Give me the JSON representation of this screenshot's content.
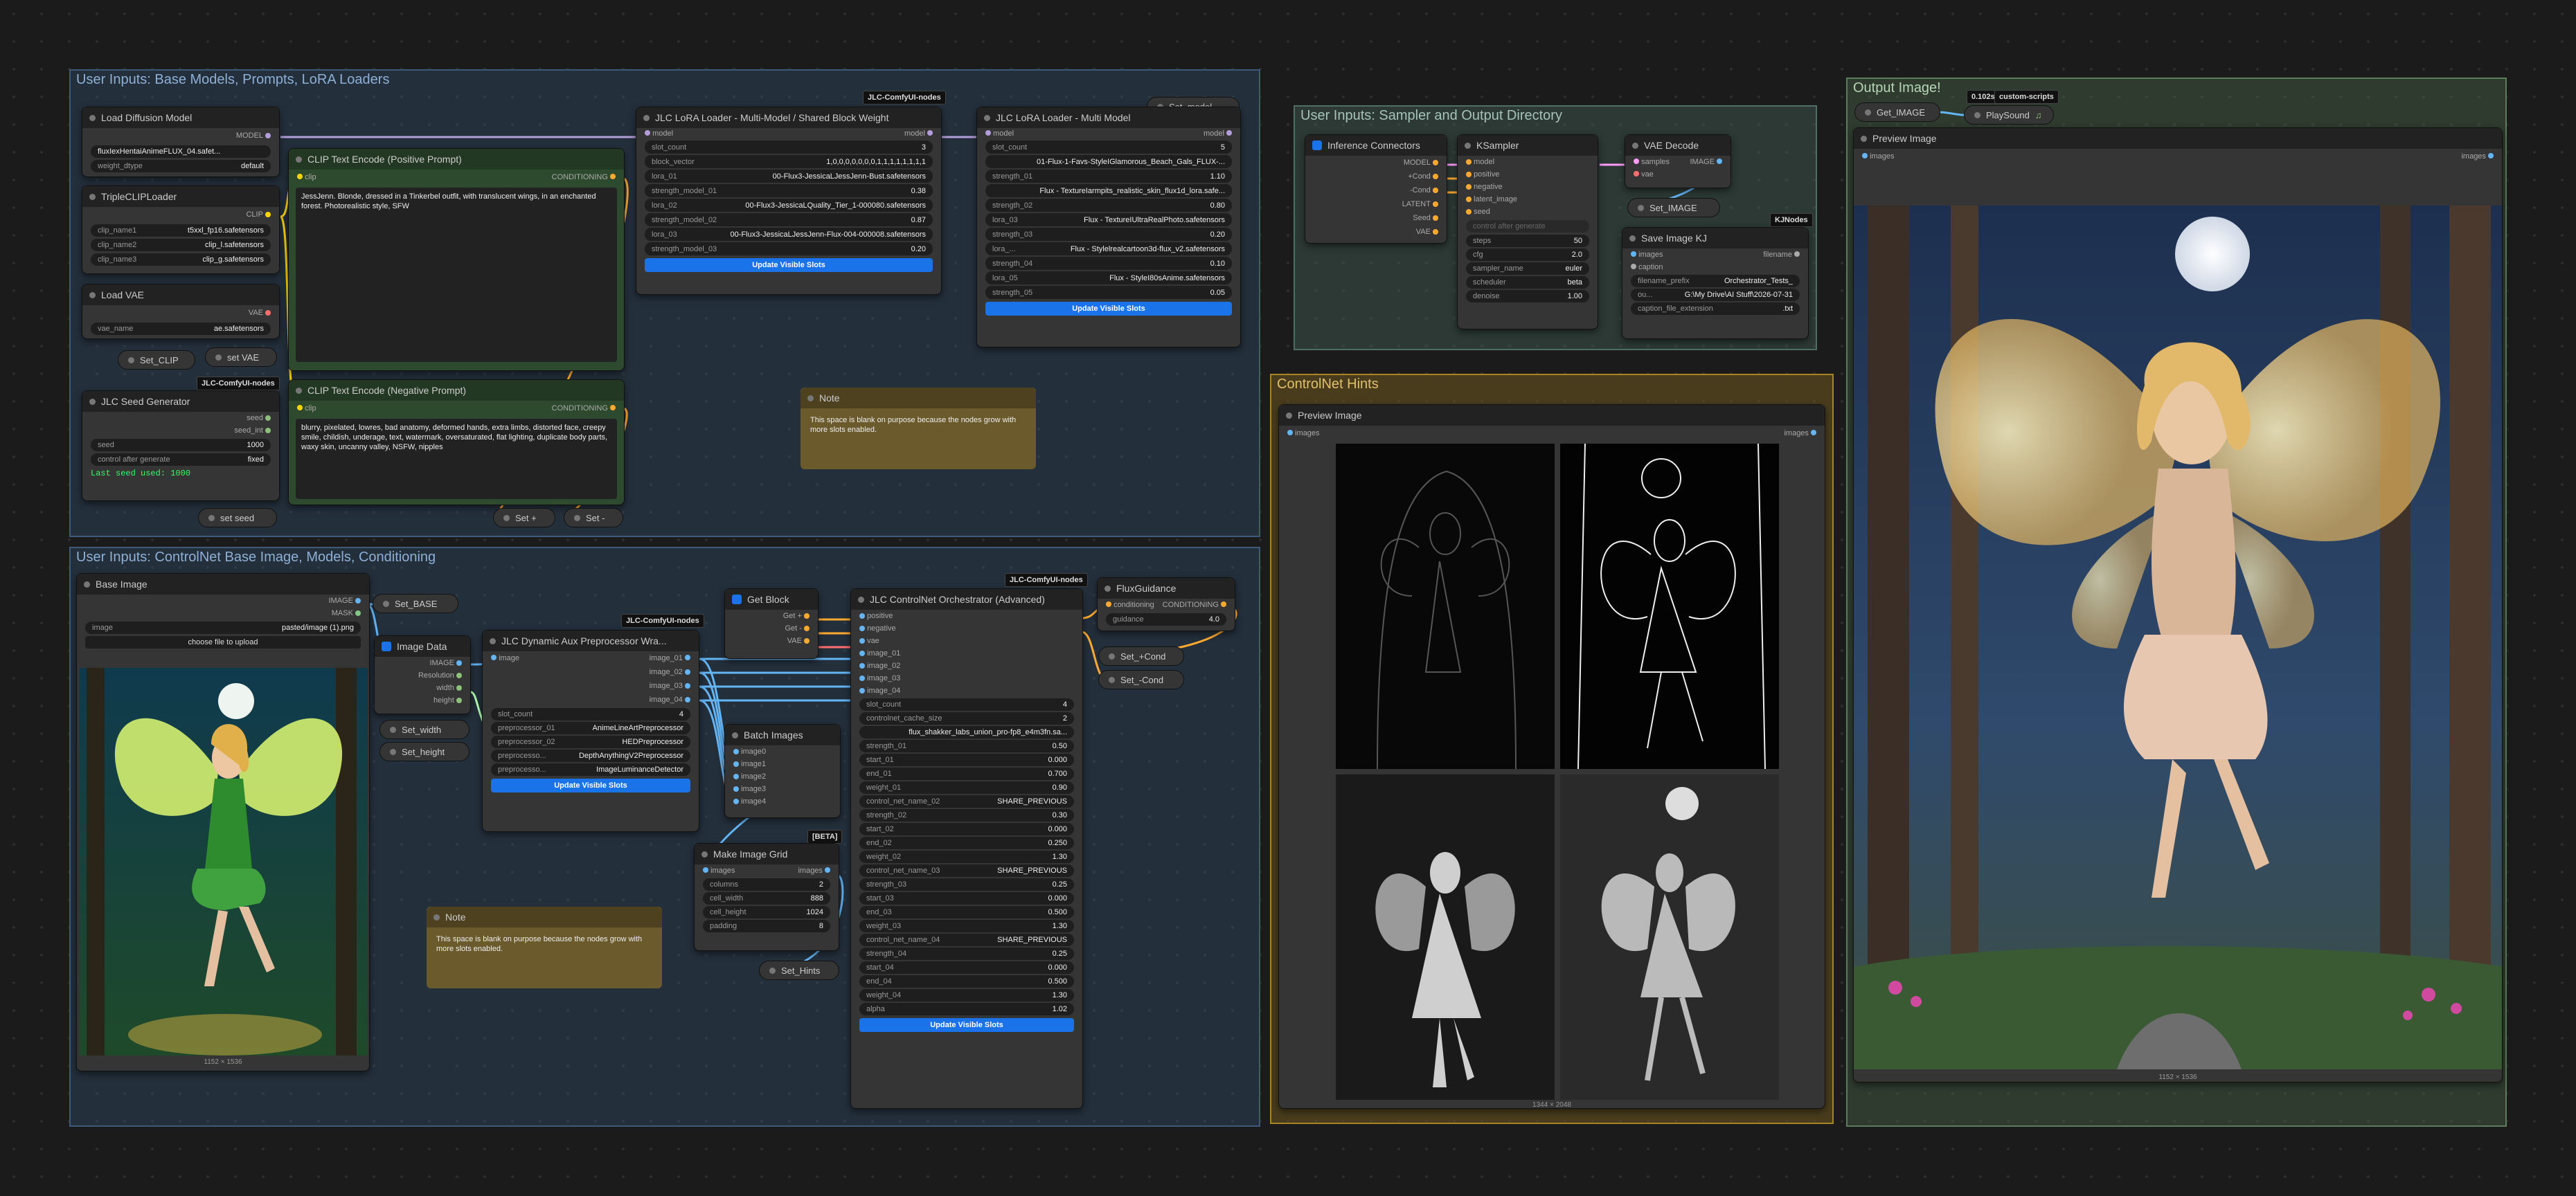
{
  "groups": {
    "base_models": "User Inputs: Base Models, Prompts, LoRA Loaders",
    "controlnet": "User Inputs: ControlNet Base Image, Models, Conditioning",
    "sampler": "User Inputs: Sampler and Output Directory",
    "hints": "ControlNet Hints",
    "output": "Output Image!"
  },
  "badges": {
    "jlc": "JLC-ComfyUI-nodes",
    "kj": "KJNodes",
    "custom_scripts": "custom-scripts",
    "time": "0.102s",
    "beta": "[BETA]"
  },
  "load_diffusion": {
    "title": "Load Diffusion Model",
    "out": "MODEL",
    "unet": "fluxIexHentaiAnimeFLUX_04.safet...",
    "weight_dtype_k": "weight_dtype",
    "weight_dtype": "default"
  },
  "triple_clip": {
    "title": "TripleCLIPLoader",
    "out": "CLIP",
    "n1_k": "clip_name1",
    "n1": "t5xxl_fp16.safetensors",
    "n2_k": "clip_name2",
    "n2": "clip_l.safetensors",
    "n3_k": "clip_name3",
    "n3": "clip_g.safetensors"
  },
  "load_vae": {
    "title": "Load VAE",
    "out": "VAE",
    "k": "vae_name",
    "v": "ae.safetensors"
  },
  "set_clip": "Set_CLIP",
  "set_vae": "set VAE",
  "seed_gen": {
    "title": "JLC Seed Generator",
    "out1": "seed",
    "out2": "seed_int",
    "seed_k": "seed",
    "seed": "1000",
    "cag_k": "control after generate",
    "cag": "fixed",
    "last": "Last seed used: 1000"
  },
  "set_seed": "set seed",
  "clip_pos": {
    "title": "CLIP Text Encode (Positive Prompt)",
    "in": "clip",
    "out": "CONDITIONING",
    "text": "JessJenn. Blonde, dressed in a Tinkerbel outfit, with translucent wings, in an enchanted forest. Photorealistic style, SFW"
  },
  "clip_neg": {
    "title": "CLIP Text Encode (Negative Prompt)",
    "in": "clip",
    "out": "CONDITIONING",
    "text": "blurry, pixelated, lowres, bad anatomy, deformed hands, extra limbs, distorted face, creepy smile, childish, underage, text, watermark, oversaturated, flat lighting, duplicate body parts, waxy skin, uncanny valley, NSFW, nipples"
  },
  "set_plus": "Set +",
  "set_minus": "Set -",
  "lora_block": {
    "title": "JLC LoRA Loader - Multi-Model / Shared Block Weight",
    "in": "model",
    "out": "model",
    "rows": [
      {
        "k": "slot_count",
        "v": "3"
      },
      {
        "k": "block_vector",
        "v": "1,0,0,0,0,0,0,0,1,1,1,1,1,1,1,1"
      },
      {
        "k": "lora_01",
        "v": "00-Flux3-JessicaLJessJenn-Bust.safetensors"
      },
      {
        "k": "strength_model_01",
        "v": "0.38"
      },
      {
        "k": "lora_02",
        "v": "00-Flux3-JessicaLQuality_Tier_1-000080.safetensors"
      },
      {
        "k": "strength_model_02",
        "v": "0.87"
      },
      {
        "k": "lora_03",
        "v": "00-Flux3-JessicaLJessJenn-Flux-004-000008.safetensors"
      },
      {
        "k": "strength_model_03",
        "v": "0.20"
      }
    ],
    "button": "Update Visible Slots"
  },
  "set_model": "Set_model",
  "lora_multi": {
    "title": "JLC LoRA Loader - Multi Model",
    "in": "model",
    "out": "model",
    "rows": [
      {
        "k": "slot_count",
        "v": "5"
      },
      {
        "k": "",
        "v": "01-Flux-1-Favs-StyleIGlamorous_Beach_Gals_FLUX-..."
      },
      {
        "k": "strength_01",
        "v": "1.10"
      },
      {
        "k": "",
        "v": "Flux - TextureIarmpits_realistic_skin_flux1d_lora.safe..."
      },
      {
        "k": "strength_02",
        "v": "0.80"
      },
      {
        "k": "lora_03",
        "v": "Flux - TextureIUltraRealPhoto.safetensors"
      },
      {
        "k": "strength_03",
        "v": "0.20"
      },
      {
        "k": "lora_...",
        "v": "Flux - Stylelrealcartoon3d-flux_v2.safetensors"
      },
      {
        "k": "strength_04",
        "v": "0.10"
      },
      {
        "k": "lora_05",
        "v": "Flux - StyleI80sAnime.safetensors"
      },
      {
        "k": "strength_05",
        "v": "0.05"
      }
    ],
    "button": "Update Visible Slots"
  },
  "note": {
    "title": "Note",
    "text": "This space is blank on purpose because the nodes grow with more slots enabled."
  },
  "inference": {
    "title": "Inference Connectors",
    "outs": [
      "MODEL",
      "+Cond",
      "-Cond",
      "LATENT",
      "Seed",
      "VAE"
    ]
  },
  "ksampler": {
    "title": "KSampler",
    "ins": [
      "model",
      "positive",
      "negative",
      "latent_image",
      "seed"
    ],
    "out": "LATENT",
    "cag": "control after generate",
    "rows": [
      {
        "k": "steps",
        "v": "50"
      },
      {
        "k": "cfg",
        "v": "2.0"
      },
      {
        "k": "sampler_name",
        "v": "euler"
      },
      {
        "k": "scheduler",
        "v": "beta"
      },
      {
        "k": "denoise",
        "v": "1.00"
      }
    ]
  },
  "vae_decode": {
    "title": "VAE Decode",
    "in1": "samples",
    "in2": "vae",
    "out": "IMAGE"
  },
  "set_image": "Set_IMAGE",
  "save_kj": {
    "title": "Save Image KJ",
    "in1": "images",
    "in2": "caption",
    "out": "filename",
    "rows": [
      {
        "k": "filename_prefix",
        "v": "Orchestrator_Tests_"
      },
      {
        "k": "ou...",
        "v": "G:\\My Drive\\AI Stuff\\2026-07-31"
      },
      {
        "k": "caption_file_extension",
        "v": ".txt"
      }
    ]
  },
  "preview_hints": {
    "title": "Preview Image",
    "in": "images",
    "out": "images",
    "cap": "1344 × 2048"
  },
  "get_image": "Get_IMAGE",
  "playsound": "PlaySound",
  "preview_out": {
    "title": "Preview Image",
    "in": "images",
    "out": "images",
    "cap": "1152 × 1536"
  },
  "base_image": {
    "title": "Base Image",
    "out1": "IMAGE",
    "out2": "MASK",
    "k": "image",
    "v": "pasted/image (1).png",
    "upload": "choose file to upload",
    "cap": "1152 × 1536"
  },
  "set_base": "Set_BASE",
  "image_data": {
    "title": "Image Data",
    "in": "IMAGE",
    "outs": [
      "Resolution",
      "width",
      "height"
    ]
  },
  "set_width": "Set_width",
  "set_height": "Set_height",
  "dyn_aux": {
    "title": "JLC Dynamic Aux Preprocessor Wra...",
    "in1": "image",
    "in2": "resolution",
    "outs": [
      "image_01",
      "image_02",
      "image_03",
      "image_04"
    ],
    "rows": [
      {
        "k": "slot_count",
        "v": "4"
      },
      {
        "k": "preprocessor_01",
        "v": "AnimeLineArtPreprocessor"
      },
      {
        "k": "preprocessor_02",
        "v": "HEDPreprocessor"
      },
      {
        "k": "preprocesso...",
        "v": "DepthAnythingV2Preprocessor"
      },
      {
        "k": "preprocesso...",
        "v": "ImageLuminanceDetector"
      }
    ],
    "button": "Update Visible Slots"
  },
  "get_block": {
    "title": "Get Block",
    "outs": [
      "Get +",
      "Get -",
      "VAE"
    ]
  },
  "batch_images": {
    "title": "Batch Images",
    "ins": [
      "image0",
      "image1",
      "image2",
      "image3",
      "image4"
    ],
    "out": "IMAGE"
  },
  "make_grid": {
    "title": "Make Image Grid",
    "in": "images",
    "out": "images",
    "rows": [
      {
        "k": "columns",
        "v": "2"
      },
      {
        "k": "cell_width",
        "v": "888"
      },
      {
        "k": "cell_height",
        "v": "1024"
      },
      {
        "k": "padding",
        "v": "8"
      }
    ]
  },
  "set_hints": "Set_Hints",
  "orchestrator": {
    "title": "JLC ControlNet Orchestrator (Advanced)",
    "ins": [
      "positive",
      "negative",
      "vae",
      "image_01",
      "image_02",
      "image_03",
      "image_04"
    ],
    "outs": [
      "CONDITIONING",
      "CONDITIONING"
    ],
    "rows": [
      {
        "k": "slot_count",
        "v": "4"
      },
      {
        "k": "controlnet_cache_size",
        "v": "2"
      },
      {
        "k": "",
        "v": "flux_shakker_labs_union_pro-fp8_e4m3fn.sa..."
      },
      {
        "k": "strength_01",
        "v": "0.50"
      },
      {
        "k": "start_01",
        "v": "0.000"
      },
      {
        "k": "end_01",
        "v": "0.700"
      },
      {
        "k": "weight_01",
        "v": "0.90"
      },
      {
        "k": "control_net_name_02",
        "v": "SHARE_PREVIOUS"
      },
      {
        "k": "strength_02",
        "v": "0.30"
      },
      {
        "k": "start_02",
        "v": "0.000"
      },
      {
        "k": "end_02",
        "v": "0.250"
      },
      {
        "k": "weight_02",
        "v": "1.30"
      },
      {
        "k": "control_net_name_03",
        "v": "SHARE_PREVIOUS"
      },
      {
        "k": "strength_03",
        "v": "0.25"
      },
      {
        "k": "start_03",
        "v": "0.000"
      },
      {
        "k": "end_03",
        "v": "0.500"
      },
      {
        "k": "weight_03",
        "v": "1.30"
      },
      {
        "k": "control_net_name_04",
        "v": "SHARE_PREVIOUS"
      },
      {
        "k": "strength_04",
        "v": "0.25"
      },
      {
        "k": "start_04",
        "v": "0.000"
      },
      {
        "k": "end_04",
        "v": "0.500"
      },
      {
        "k": "weight_04",
        "v": "1.30"
      },
      {
        "k": "alpha",
        "v": "1.02"
      }
    ],
    "button": "Update Visible Slots"
  },
  "flux_guidance": {
    "title": "FluxGuidance",
    "in": "conditioning",
    "out": "CONDITIONING",
    "k": "guidance",
    "v": "4.0"
  },
  "set_pcond": "Set_+Cond",
  "set_ncond": "Set_-Cond",
  "colors": {
    "wire_model": "#b39ddb",
    "wire_cond": "#ffa931",
    "wire_image": "#64b5f6",
    "wire_clip": "#ffd500",
    "wire_vae": "#ff6e6e",
    "accent": "#1a73e8"
  }
}
